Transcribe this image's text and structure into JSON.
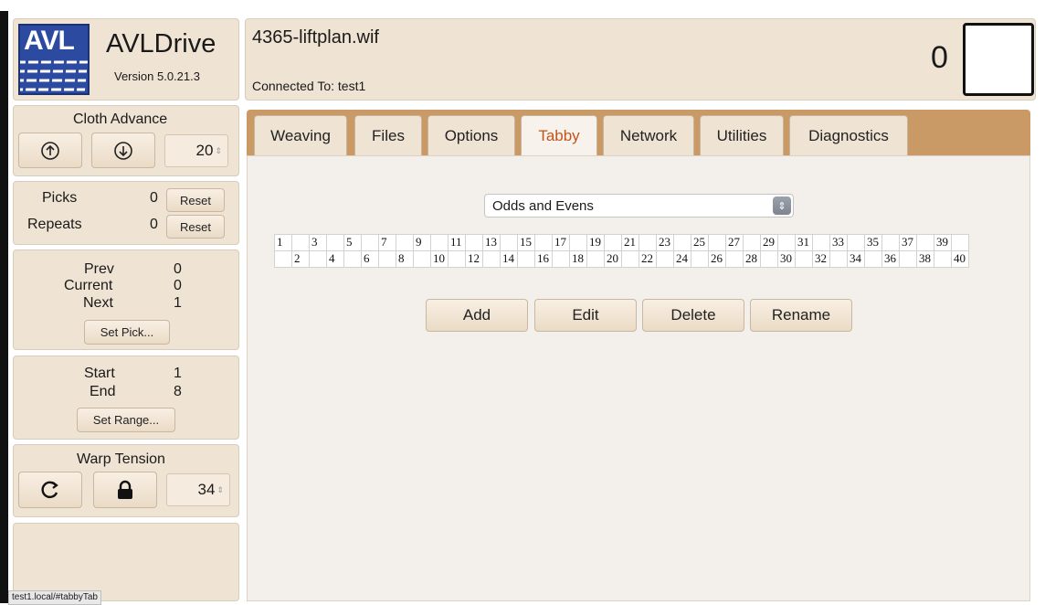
{
  "app": {
    "logo_text": "AVL",
    "name": "AVLDrive",
    "version": "Version 5.0.21.3"
  },
  "file": {
    "name": "4365-liftplan.wif",
    "connection": "Connected To: test1"
  },
  "pick_display": {
    "value": "0"
  },
  "cloth_advance": {
    "title": "Cloth Advance",
    "up_icon": "arrow-up-circle-icon",
    "down_icon": "arrow-down-circle-icon",
    "amount": "20"
  },
  "counters": {
    "picks_label": "Picks",
    "picks_value": "0",
    "picks_reset": "Reset",
    "repeats_label": "Repeats",
    "repeats_value": "0",
    "repeats_reset": "Reset"
  },
  "position": {
    "prev_label": "Prev",
    "prev_value": "0",
    "current_label": "Current",
    "current_value": "0",
    "next_label": "Next",
    "next_value": "1",
    "set_pick": "Set Pick..."
  },
  "range": {
    "start_label": "Start",
    "start_value": "1",
    "end_label": "End",
    "end_value": "8",
    "set_range": "Set Range..."
  },
  "warp_tension": {
    "title": "Warp Tension",
    "refresh_icon": "refresh-icon",
    "lock_icon": "lock-icon",
    "amount": "34"
  },
  "tabs": [
    {
      "label": "Weaving"
    },
    {
      "label": "Files"
    },
    {
      "label": "Options"
    },
    {
      "label": "Tabby"
    },
    {
      "label": "Network"
    },
    {
      "label": "Utilities"
    },
    {
      "label": "Diagnostics"
    }
  ],
  "active_tab": "Tabby",
  "tabby": {
    "selected": "Odds and Evens",
    "odd_numbers": [
      "1",
      "3",
      "5",
      "7",
      "9",
      "11",
      "13",
      "15",
      "17",
      "19",
      "21",
      "23",
      "25",
      "27",
      "29",
      "31",
      "33",
      "35",
      "37",
      "39"
    ],
    "even_numbers": [
      "2",
      "4",
      "6",
      "8",
      "10",
      "12",
      "14",
      "16",
      "18",
      "20",
      "22",
      "24",
      "26",
      "28",
      "30",
      "32",
      "34",
      "36",
      "38",
      "40"
    ],
    "buttons": {
      "add": "Add",
      "edit": "Edit",
      "delete": "Delete",
      "rename": "Rename"
    }
  },
  "status_url": "test1.local/#tabbyTab",
  "colors": {
    "panel": "#efe3d3",
    "tab_bar": "#c99a66",
    "active_tab_text": "#c2551d",
    "logo_blue": "#2b4aa0"
  }
}
